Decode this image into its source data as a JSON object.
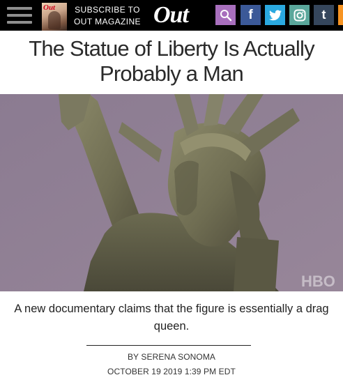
{
  "header": {
    "subscribe_line1": "SUBSCRIBE TO",
    "subscribe_line2": "OUT MAGAZINE",
    "logo": "Out",
    "magazine_cover_mast": "Out",
    "social": {
      "search_icon": "search-icon",
      "facebook_glyph": "f",
      "twitter_icon": "twitter-icon",
      "instagram_icon": "instagram-icon",
      "tumblr_glyph": "t",
      "rss_icon": "rss-icon"
    },
    "colors": {
      "bar": "#000000",
      "search": "#a86fbd",
      "facebook": "#3b5998",
      "twitter": "#2aa9e0",
      "instagram": "#5aa79b",
      "tumblr": "#35465c",
      "rss": "#f79422"
    }
  },
  "article": {
    "headline": "The Statue of Liberty Is Actually Probably a Man",
    "image_watermark": "HBO",
    "dek": "A new documentary claims that the figure is essentially a drag queen.",
    "byline": "BY SERENA SONOMA",
    "date": "OCTOBER 19 2019 1:39 PM EDT"
  }
}
